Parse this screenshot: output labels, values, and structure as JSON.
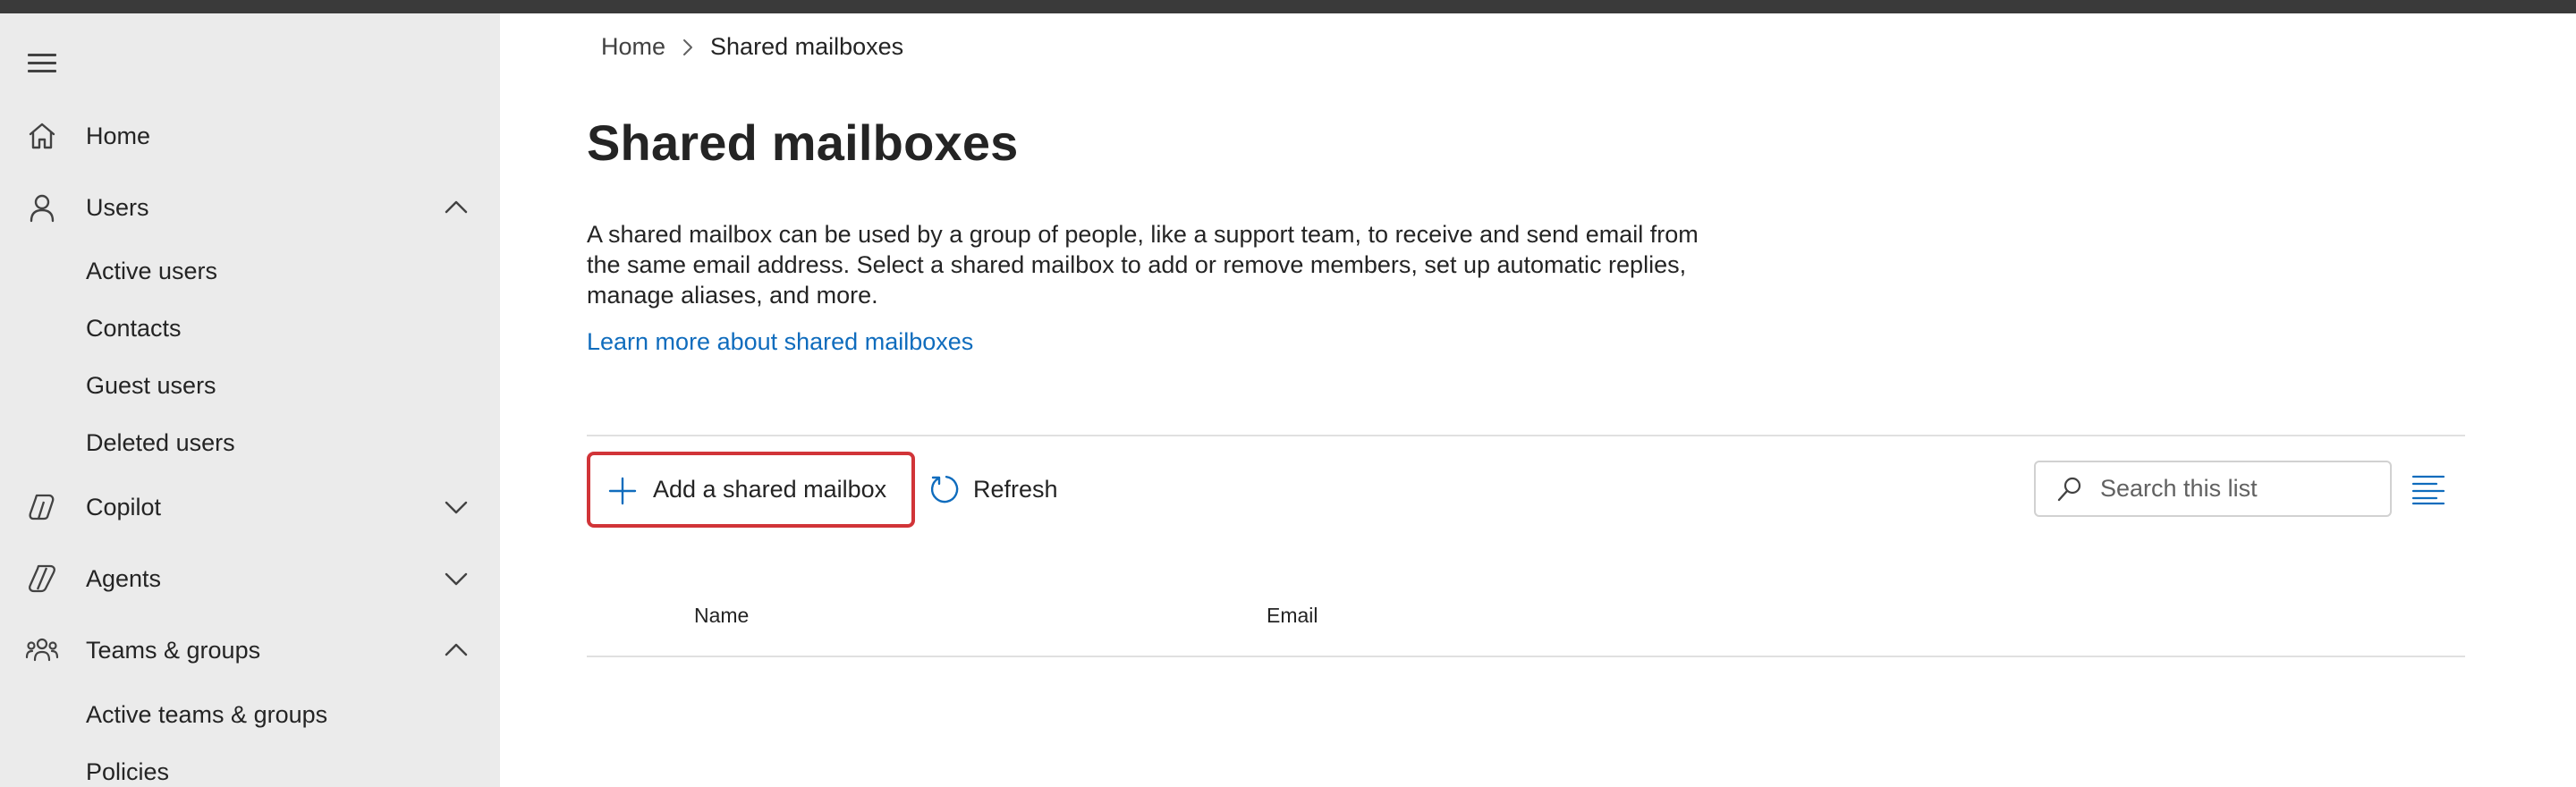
{
  "sidebar": {
    "menu_icon": "hamburger-icon",
    "items": [
      {
        "label": "Home",
        "icon": "home-icon"
      },
      {
        "label": "Users",
        "icon": "person-icon",
        "expanded": true,
        "children": [
          "Active users",
          "Contacts",
          "Guest users",
          "Deleted users"
        ]
      },
      {
        "label": "Copilot",
        "icon": "copilot-icon",
        "expanded": false
      },
      {
        "label": "Agents",
        "icon": "agents-icon",
        "expanded": false
      },
      {
        "label": "Teams & groups",
        "icon": "people-team-icon",
        "expanded": true,
        "children": [
          "Active teams & groups",
          "Policies"
        ]
      }
    ]
  },
  "breadcrumb": {
    "home": "Home",
    "current": "Shared mailboxes"
  },
  "page": {
    "title": "Shared mailboxes",
    "description": "A shared mailbox can be used by a group of people, like a support team, to receive and send email from the same email address. Select a shared mailbox to add or remove members, set up automatic replies, manage aliases, and more.",
    "learn_more": "Learn more about shared mailboxes"
  },
  "toolbar": {
    "add_label": "Add a shared mailbox",
    "refresh_label": "Refresh",
    "search_placeholder": "Search this list"
  },
  "table": {
    "columns": [
      "Name",
      "Email"
    ]
  },
  "colors": {
    "accent": "#0f6cbd",
    "highlight_border": "#d13438",
    "sidebar_bg": "#ebebeb",
    "topbar": "#3a3a3a"
  }
}
